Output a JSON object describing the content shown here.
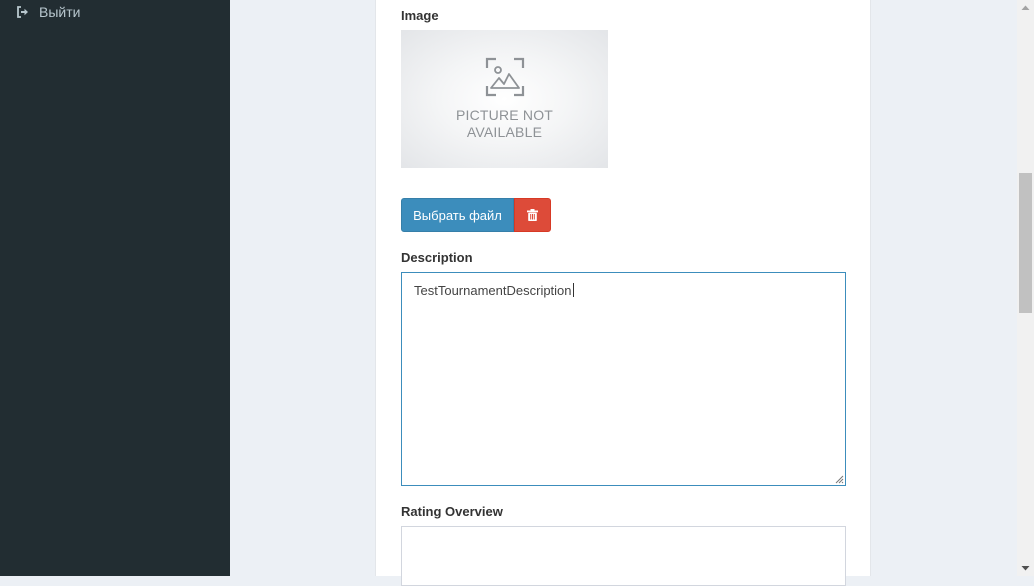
{
  "sidebar": {
    "logout_label": "Выйти",
    "logout_icon": "sign-out-icon"
  },
  "form": {
    "image_label": "Image",
    "image_placeholder_text": "PICTURE NOT AVAILABLE",
    "image_placeholder_line1": "PICTURE NOT",
    "image_placeholder_line2": "AVAILABLE",
    "choose_file_label": "Выбрать файл",
    "delete_icon": "trash-icon",
    "description_label": "Description",
    "description_value": "TestTournamentDescription",
    "rating_overview_label": "Rating Overview",
    "rating_overview_value": ""
  },
  "colors": {
    "sidebar_bg": "#222d32",
    "primary": "#3c8dbc",
    "danger": "#dd4b39",
    "content_bg": "#ecf0f5"
  }
}
